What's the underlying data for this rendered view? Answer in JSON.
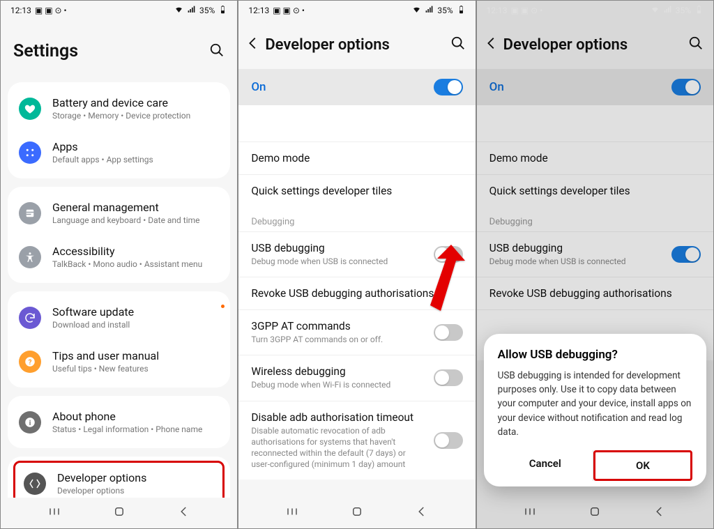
{
  "status": {
    "time": "12:13",
    "battery": "35%"
  },
  "s1": {
    "title": "Settings",
    "groups": [
      [
        {
          "icon": "heart-icon",
          "ic": "ic-green",
          "title": "Battery and device care",
          "sub": "Storage  •  Memory  •  Device protection"
        },
        {
          "icon": "apps-icon",
          "ic": "ic-blue",
          "title": "Apps",
          "sub": "Default apps  •  App settings"
        }
      ],
      [
        {
          "icon": "general-icon",
          "ic": "ic-grey",
          "title": "General management",
          "sub": "Language and keyboard  •  Date and time"
        },
        {
          "icon": "accessibility-icon",
          "ic": "ic-grey",
          "title": "Accessibility",
          "sub": "TalkBack  •  Mono audio  •  Assistant menu"
        }
      ],
      [
        {
          "icon": "update-icon",
          "ic": "ic-purple",
          "title": "Software update",
          "sub": "Download and install",
          "dot": true
        },
        {
          "icon": "tips-icon",
          "ic": "ic-orange",
          "title": "Tips and user manual",
          "sub": "Useful tips  •  New features"
        }
      ],
      [
        {
          "icon": "about-icon",
          "ic": "ic-dark",
          "title": "About phone",
          "sub": "Status  •  Legal information  •  Phone name"
        }
      ],
      [
        {
          "icon": "dev-icon",
          "ic": "ic-darker",
          "title": "Developer options",
          "sub": "Developer options",
          "highlight": true
        }
      ]
    ]
  },
  "dev": {
    "title": "Developer options",
    "on_label": "On",
    "rows": {
      "demo": "Demo mode",
      "tiles": "Quick settings developer tiles",
      "section_debug": "Debugging",
      "usb_t": "USB debugging",
      "usb_s": "Debug mode when USB is connected",
      "revoke": "Revoke USB debugging authorisations",
      "gpp_t": "3GPP AT commands",
      "gpp_s": "Turn 3GPP AT commands on or off.",
      "wifi_t": "Wireless debugging",
      "wifi_s": "Debug mode when Wi-Fi is connected",
      "adb_t": "Disable adb authorisation timeout",
      "adb_s": "Disable automatic revocation of adb authorisations for systems that haven't reconnected within the default (7 days) or user-configured (minimum 1 day) amount",
      "adb_peek": "user-configured (minimum 1 day) amount"
    }
  },
  "dialog": {
    "title": "Allow USB debugging?",
    "body": "USB debugging is intended for development purposes only. Use it to copy data between your computer and your device, install apps on your device without notification and read log data.",
    "cancel": "Cancel",
    "ok": "OK"
  }
}
